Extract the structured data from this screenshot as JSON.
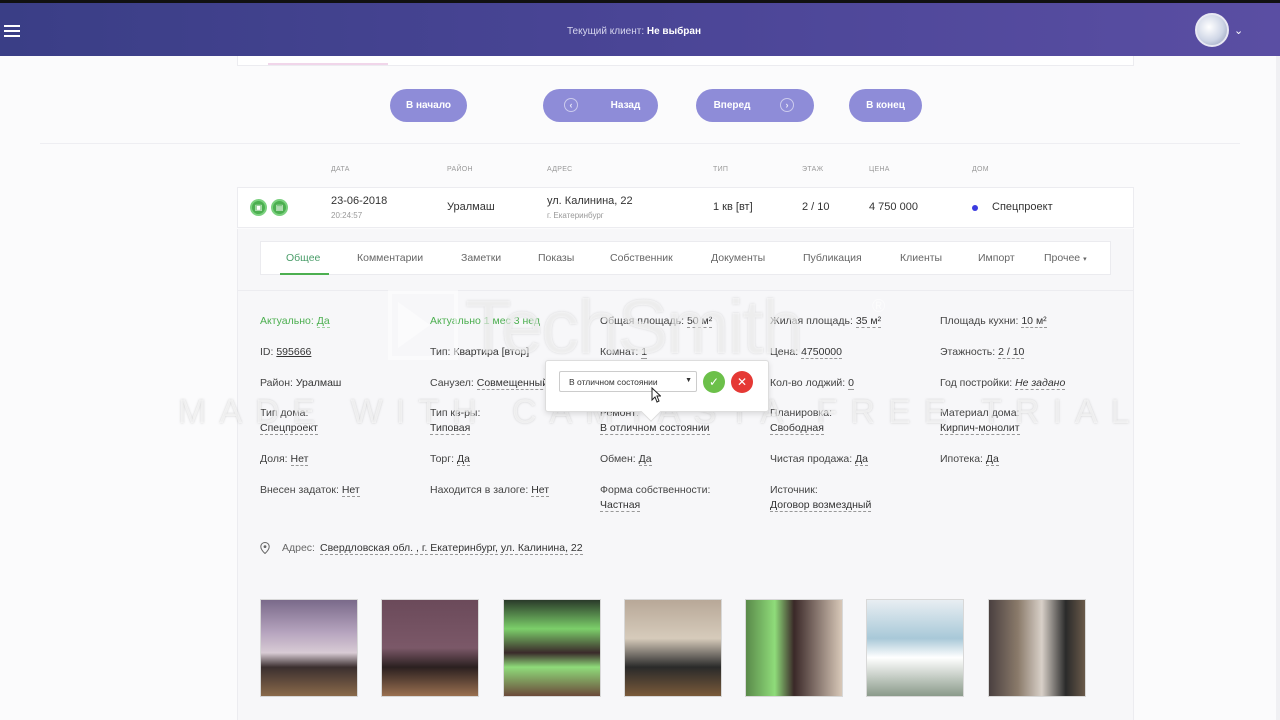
{
  "header": {
    "client_label": "Текущий клиент:",
    "client_value": "Не выбран"
  },
  "pager": {
    "first": "В начало",
    "back": "Назад",
    "forward": "Вперед",
    "last": "В конец"
  },
  "table": {
    "headers": [
      "Дата",
      "Район",
      "Адрес",
      "Тип",
      "Этаж",
      "Цена",
      "Дом"
    ],
    "row": {
      "date": "23-06-2018",
      "time": "20:24:57",
      "district": "Уралмаш",
      "address": "ул. Калинина, 22",
      "city": "г. Екатеринбург",
      "type": "1 кв [вт]",
      "floor": "2 / 10",
      "price": "4 750 000",
      "house": "Спецпроект"
    }
  },
  "tabs": [
    "Общее",
    "Комментарии",
    "Заметки",
    "Показы",
    "Собственник",
    "Документы",
    "Публикация",
    "Клиенты",
    "Импорт",
    "Прочее"
  ],
  "fields": {
    "actual_label": "Актуально:",
    "actual_value": "Да",
    "actual_period": "Актуально 1 мес 3 нед",
    "total_area_label": "Общая площадь:",
    "total_area_value": "50 м²",
    "living_area_label": "Жилая площадь:",
    "living_area_value": "35 м²",
    "kitchen_area_label": "Площадь кухни:",
    "kitchen_area_value": "10 м²",
    "id_label": "ID:",
    "id_value": "595666",
    "type_label": "Тип:",
    "type_value": "Квартира [втор]",
    "rooms_label": "Комнат:",
    "rooms_value": "1",
    "price_label": "Цена:",
    "price_value": "4750000",
    "floors_label": "Этажность:",
    "floors_value": "2 / 10",
    "district_label": "Район:",
    "district_value": "Уралмаш",
    "bathroom_label": "Санузел:",
    "bathroom_value": "Совмещенный",
    "loggia_label": "Кол-во лоджий:",
    "loggia_value": "0",
    "year_label": "Год постройки:",
    "year_value": "Не задано",
    "house_type_label": "Тип дома:",
    "house_type_value": "Спецпроект",
    "flat_type_label": "Тип кв-ры:",
    "flat_type_value": "Типовая",
    "repair_label": "Ремонт:",
    "repair_value": "В отличном состоянии",
    "layout_label": "Планировка:",
    "layout_value": "Свободная",
    "material_label": "Материал дома:",
    "material_value": "Кирпич-монолит",
    "share_label": "Доля:",
    "share_value": "Нет",
    "bargain_label": "Торг:",
    "bargain_value": "Да",
    "exchange_label": "Обмен:",
    "exchange_value": "Да",
    "clean_sale_label": "Чистая продажа:",
    "clean_sale_value": "Да",
    "mortgage_label": "Ипотека:",
    "mortgage_value": "Да",
    "deposit_label": "Внесен задаток:",
    "deposit_value": "Нет",
    "pledge_label": "Находится в залоге:",
    "pledge_value": "Нет",
    "ownership_label": "Форма собственности:",
    "ownership_value": "Частная",
    "source_label": "Источник:",
    "source_value": "Договор возмездный"
  },
  "address": {
    "label": "Адрес:",
    "value": "Свердловская обл. , г. Екатеринбург, ул. Калинина, 22"
  },
  "popover": {
    "selected": "В отличном состоянии"
  },
  "watermark": {
    "brand": "TechSmith",
    "trial": "MADE WITH CAMTASTA FREE TRIAL"
  },
  "colors": {
    "header_start": "#3a3e86",
    "header_end": "#5a4ea3",
    "pager_button": "#8e8cd8",
    "accent_green": "#4caf50",
    "cancel_red": "#e53935",
    "house_dot": "#3b3be0"
  },
  "icons": [
    "menu-icon",
    "user-avatar",
    "chevron-down-icon",
    "arrow-left-icon",
    "arrow-right-icon",
    "camera-icon",
    "document-icon",
    "map-pin-icon",
    "check-icon",
    "close-icon"
  ]
}
